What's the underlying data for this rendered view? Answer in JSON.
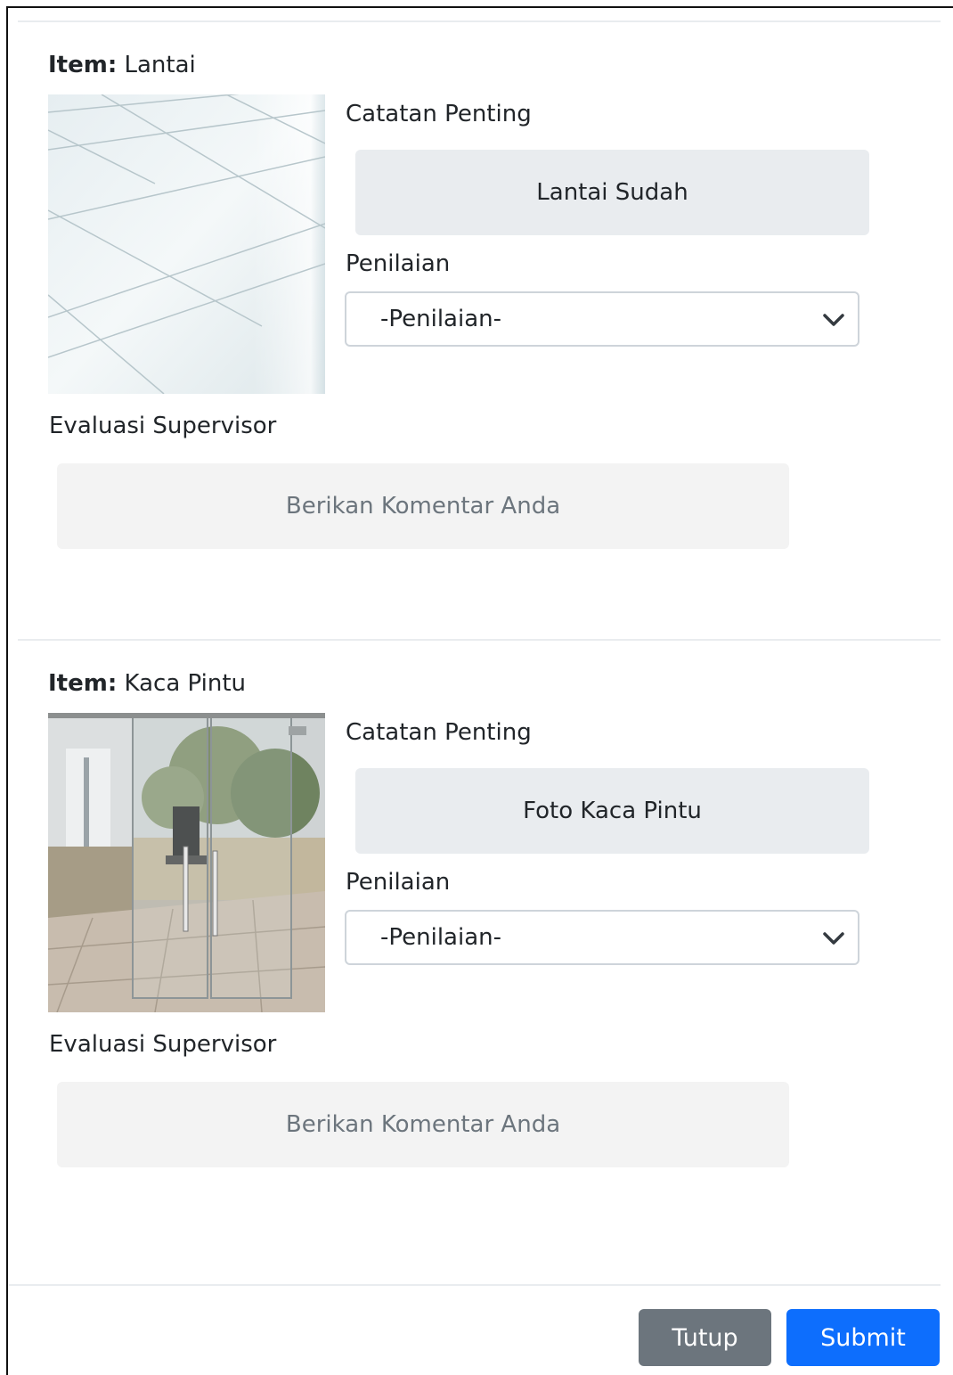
{
  "items": [
    {
      "title_label": "Item:",
      "title_value": "Lantai",
      "photo_icon": "floor-tiles-photo",
      "catatan_label": "Catatan Penting",
      "catatan_value": "Lantai Sudah",
      "penilaian_label": "Penilaian",
      "penilaian_selected": "-Penilaian-",
      "evaluasi_label": "Evaluasi Supervisor",
      "komentar_placeholder": "Berikan Komentar Anda"
    },
    {
      "title_label": "Item:",
      "title_value": "Kaca Pintu",
      "photo_icon": "glass-door-photo",
      "catatan_label": "Catatan Penting",
      "catatan_value": "Foto Kaca Pintu",
      "penilaian_label": "Penilaian",
      "penilaian_selected": "-Penilaian-",
      "evaluasi_label": "Evaluasi Supervisor",
      "komentar_placeholder": "Berikan Komentar Anda"
    }
  ],
  "footer": {
    "close_label": "Tutup",
    "submit_label": "Submit"
  },
  "colors": {
    "primary": "#0d6efd",
    "secondary": "#6c757d",
    "note_bg": "#e9ecef",
    "comment_bg": "#f3f3f3"
  }
}
